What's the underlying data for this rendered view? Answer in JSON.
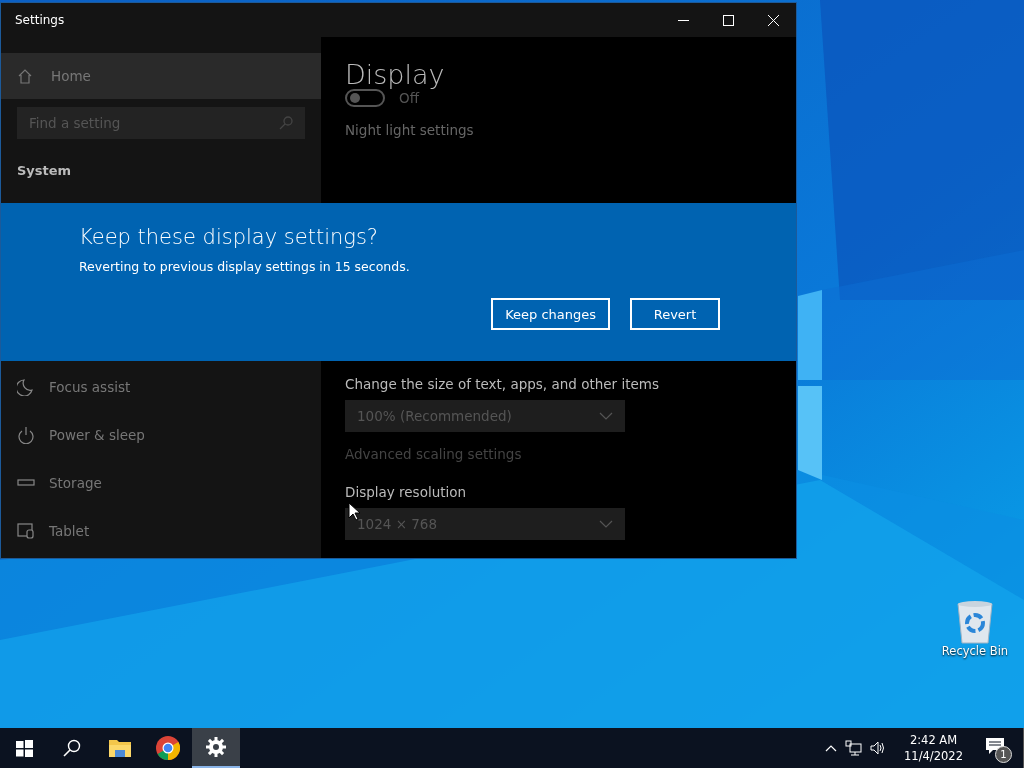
{
  "window": {
    "title": "Settings"
  },
  "sidebar": {
    "home": {
      "label": "Home",
      "selected": true
    },
    "search": {
      "placeholder": "Find a setting"
    },
    "section": "System",
    "items": [
      {
        "label": "Focus assist",
        "selected": false
      },
      {
        "label": "Power & sleep",
        "selected": false
      },
      {
        "label": "Storage",
        "selected": false
      },
      {
        "label": "Tablet",
        "selected": false
      }
    ]
  },
  "content": {
    "title": "Display",
    "night_light": {
      "on": false,
      "label": "Off"
    },
    "night_light_link": "Night light settings",
    "scale_label": "Change the size of text, apps, and other items",
    "scale_value": "100% (Recommended)",
    "advanced_link": {
      "text": "Advanced scaling settings",
      "disabled": true
    },
    "resolution_label": "Display resolution",
    "resolution_value": "1024 × 768"
  },
  "dialog": {
    "title": "Keep these display settings?",
    "message": "Reverting to previous display settings in 15 seconds.",
    "buttons": [
      "Keep changes",
      "Revert"
    ]
  },
  "desktop_icons": [
    {
      "label": "Recycle Bin"
    }
  ],
  "taskbar": {
    "apps": [
      {
        "selected": false
      },
      {
        "selected": false
      },
      {
        "selected": false
      },
      {
        "selected": true
      }
    ],
    "time": "2:42 AM",
    "date": "11/4/2022",
    "notification_count": "1"
  }
}
